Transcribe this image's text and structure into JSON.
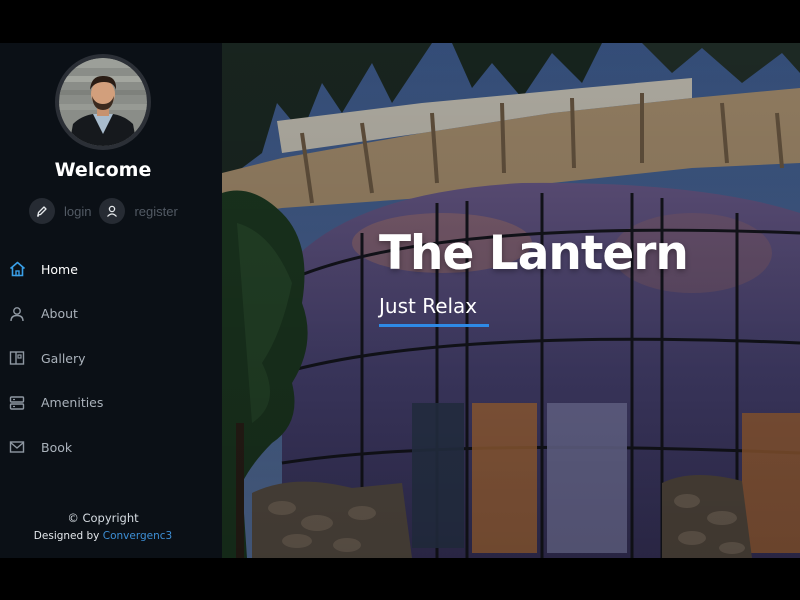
{
  "sidebar": {
    "welcome": "Welcome",
    "auth": {
      "login_label": "login",
      "login_icon": "pen-icon",
      "register_label": "register",
      "register_icon": "user-icon"
    },
    "items": [
      {
        "label": "Home",
        "icon": "home-icon",
        "active": true
      },
      {
        "label": "About",
        "icon": "user-icon",
        "active": false
      },
      {
        "label": "Gallery",
        "icon": "gallery-icon",
        "active": false
      },
      {
        "label": "Amenities",
        "icon": "server-icon",
        "active": false
      },
      {
        "label": "Book",
        "icon": "mail-icon",
        "active": false
      }
    ],
    "footer": {
      "copyright": "© Copyright",
      "designed_by": "Designed by",
      "brand": "Convergenc3"
    }
  },
  "hero": {
    "title": "The Lantern",
    "subtitle": "Just Relax"
  },
  "colors": {
    "sidebar_bg": "#0b1016",
    "accent": "#2e8ae6",
    "brand_link": "#3d8fd6",
    "active_icon": "#3aa0e8"
  }
}
